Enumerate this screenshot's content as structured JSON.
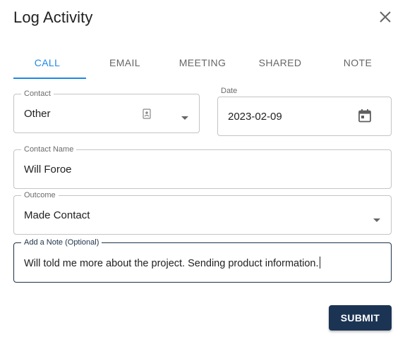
{
  "dialog": {
    "title": "Log Activity"
  },
  "tabs": [
    {
      "label": "CALL",
      "active": true
    },
    {
      "label": "EMAIL",
      "active": false
    },
    {
      "label": "MEETING",
      "active": false
    },
    {
      "label": "SHARED",
      "active": false
    },
    {
      "label": "NOTE",
      "active": false
    }
  ],
  "form": {
    "contact": {
      "label": "Contact",
      "value": "Other"
    },
    "date": {
      "label": "Date",
      "value": "2023-02-09"
    },
    "contact_name": {
      "label": "Contact Name",
      "value": "Will Foroe"
    },
    "outcome": {
      "label": "Outcome",
      "value": "Made Contact"
    },
    "note": {
      "label": "Add a Note (Optional)",
      "value": "Will told me more about the project. Sending product information."
    }
  },
  "actions": {
    "submit_label": "SUBMIT"
  },
  "colors": {
    "accent": "#1e88e5",
    "primary_button": "#1c3454",
    "focused_border": "#1c3149"
  }
}
